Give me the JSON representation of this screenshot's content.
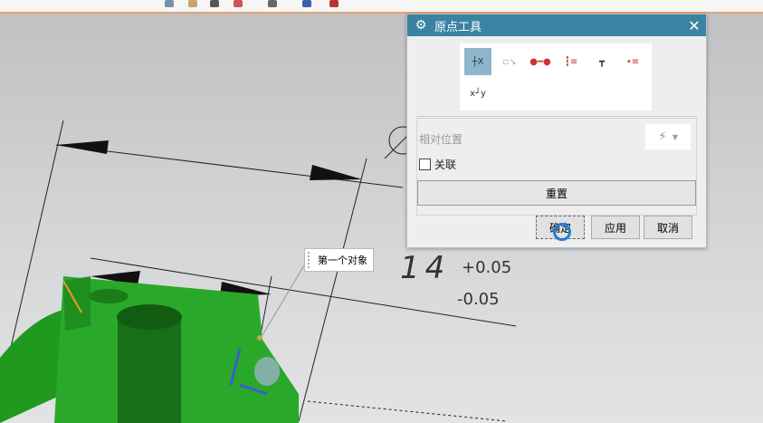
{
  "dialog": {
    "title": "原点工具",
    "close": "✕",
    "relative_position_label": "相对位置",
    "associative_label": "关联",
    "reset_label": "重置",
    "ok_label": "确定",
    "apply_label": "应用",
    "cancel_label": "取消",
    "dropdown_glyph": "⚡"
  },
  "tooltip": {
    "text": "第一个对象"
  },
  "dimension": {
    "nominal": "14",
    "upper_tol": "+0.05",
    "lower_tol": "-0.05"
  },
  "colors": {
    "titlebar": "#3a83a3",
    "part": "#27a327",
    "accent": "#e3a46e"
  }
}
